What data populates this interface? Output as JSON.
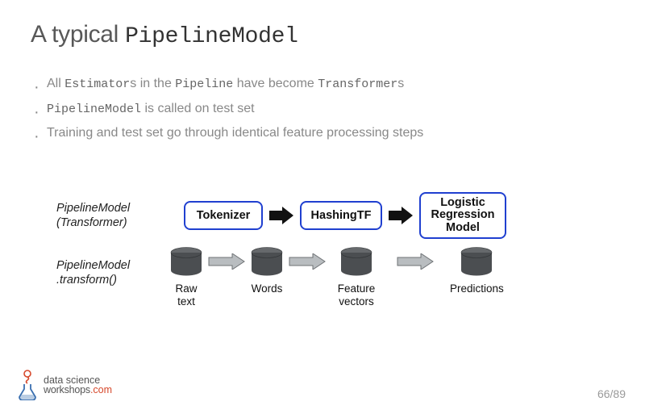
{
  "title": {
    "pre": "A typical ",
    "code": "PipelineModel"
  },
  "bullets": [
    {
      "parts": [
        "All ",
        "Estimator",
        "s in the ",
        "Pipeline",
        " have become ",
        "Transformer",
        "s"
      ]
    },
    {
      "parts": [
        "",
        "PipelineModel",
        " is called on test set"
      ]
    },
    {
      "text": "Training and test set go through identical feature processing steps"
    }
  ],
  "diagram": {
    "row1_label": "PipelineModel\n(Transformer)",
    "row2_label": "PipelineModel\n.transform()",
    "boxes": {
      "tokenizer": "Tokenizer",
      "hashing": "HashingTF",
      "lr": "Logistic\nRegression\nModel"
    },
    "cols": {
      "raw": "Raw\ntext",
      "words": "Words",
      "feat": "Feature\nvectors",
      "pred": "Predictions"
    }
  },
  "footer": {
    "brand1": "data science",
    "brand2": "workshops",
    "brand3": ".com",
    "page": "66/89"
  }
}
